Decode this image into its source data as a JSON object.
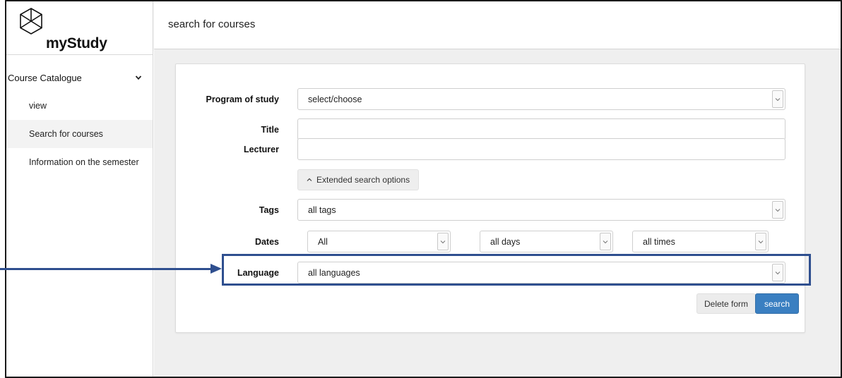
{
  "app": {
    "name": "myStudy",
    "logo_icon": "hexagon-cube-icon"
  },
  "sidebar": {
    "group_label": "Course Catalogue",
    "items": [
      {
        "label": "view",
        "active": false
      },
      {
        "label": "Search for courses",
        "active": true
      },
      {
        "label": "Information on the semester",
        "active": false
      }
    ]
  },
  "header": {
    "title": "search for courses"
  },
  "form": {
    "program": {
      "label": "Program of study",
      "value": "select/choose"
    },
    "title": {
      "label": "Title",
      "value": ""
    },
    "lecturer": {
      "label": "Lecturer",
      "value": ""
    },
    "extended_label": "Extended search options",
    "tags": {
      "label": "Tags",
      "value": "all tags"
    },
    "dates": {
      "label": "Dates",
      "period": "All",
      "days": "all days",
      "times": "all times"
    },
    "language": {
      "label": "Language",
      "value": "all languages"
    },
    "delete_label": "Delete form",
    "search_label": "search"
  },
  "colors": {
    "accent": "#3a7fc1",
    "highlight": "#2f4f8f"
  }
}
